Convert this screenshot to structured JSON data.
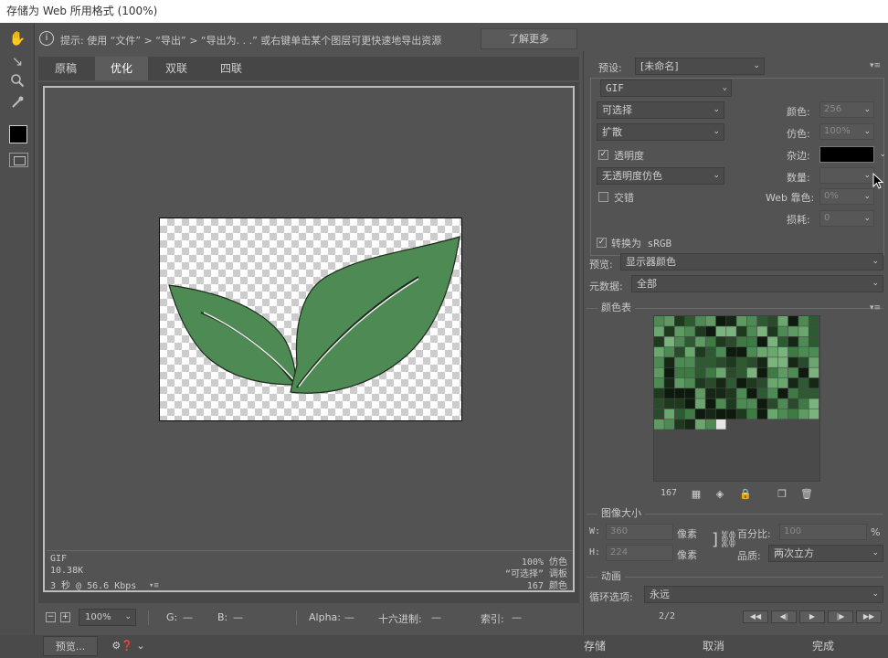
{
  "window": {
    "title": "存储为 Web 所用格式 (100%)"
  },
  "tools": [
    {
      "name": "hand-icon",
      "glyph": "✋"
    },
    {
      "name": "slice-select-icon",
      "glyph": "↖"
    },
    {
      "name": "zoom-icon",
      "glyph": "🔍"
    },
    {
      "name": "eyedropper-icon",
      "glyph": "✎"
    }
  ],
  "hint": {
    "icon": "i",
    "text": "提示:  使用 “文件” > “导出” > “导出为. . .” 或右键单击某个图层可更快速地导出资源",
    "learn_more": "了解更多"
  },
  "tabs": [
    {
      "label": "原稿"
    },
    {
      "label": "优化"
    },
    {
      "label": "双联"
    },
    {
      "label": "四联"
    }
  ],
  "image_info": {
    "format": "GIF",
    "size": "10.38K",
    "time": "3 秒 @ 56.6 Kbps",
    "dither": "100% 仿色",
    "palette": "“可选择” 调板",
    "colors": "167 颜色"
  },
  "status": {
    "zoom": "100%",
    "g_label": "G:",
    "g_value": "—",
    "b_label": "B:",
    "b_value": "—",
    "alpha_label": "Alpha:",
    "alpha_value": "—",
    "hex_label": "十六进制:",
    "hex_value": "—",
    "index_label": "索引:",
    "index_value": "—"
  },
  "bottom": {
    "preview": "预览...",
    "save": "存储",
    "cancel": "取消",
    "done": "完成"
  },
  "settings": {
    "preset_label": "预设:",
    "preset_value": "[未命名]",
    "format": "GIF",
    "reduction": "可选择",
    "dither_algo": "扩散",
    "transparency_label": "透明度",
    "transparency_checked": true,
    "trans_dither": "无透明度仿色",
    "interlaced_label": "交错",
    "interlaced_checked": false,
    "colors_label": "颜色:",
    "colors_value": "256",
    "dither_label": "仿色:",
    "dither_value": "100%",
    "matte_label": "杂边:",
    "matte_color": "#000000",
    "amount_label": "数量:",
    "amount_value": "",
    "web_snap_label": "Web 靠色:",
    "web_snap_value": "0%",
    "lossy_label": "损耗:",
    "lossy_value": "0",
    "srgb_label": "转换为 sRGB",
    "srgb_checked": true,
    "preview_label": "预览:",
    "preview_value": "显示器颜色",
    "metadata_label": "元数据:",
    "metadata_value": "全部"
  },
  "color_table": {
    "title": "颜色表",
    "count": "167"
  },
  "image_size": {
    "title": "图像大小",
    "w_label": "W:",
    "w_value": "360",
    "h_label": "H:",
    "h_value": "224",
    "unit": "像素",
    "percent_label": "百分比:",
    "percent_value": "100",
    "percent_unit": "%",
    "quality_label": "品质:",
    "quality_value": "两次立方"
  },
  "animation": {
    "title": "动画",
    "loop_label": "循环选项:",
    "loop_value": "永远",
    "frame": "2/2"
  },
  "colors": {
    "leaf": "#4e8a53",
    "leaf_outline": "#1e2a1e",
    "panel": "#535353"
  }
}
